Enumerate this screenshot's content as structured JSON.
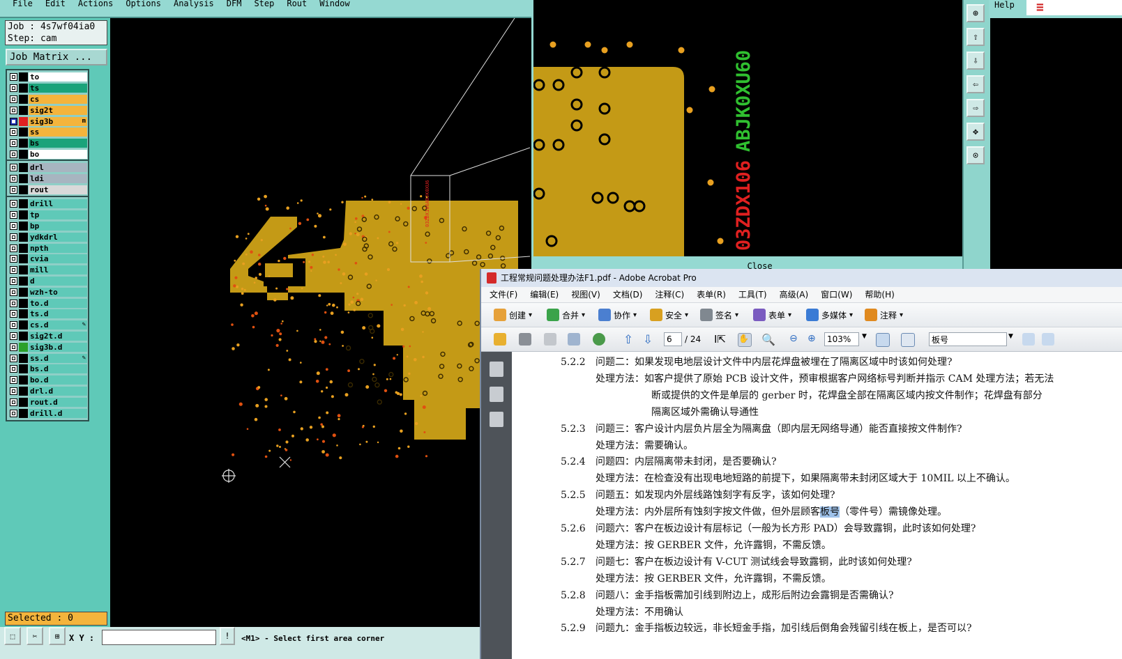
{
  "cam": {
    "menu": [
      "File",
      "Edit",
      "Actions",
      "Options",
      "Analysis",
      "DFM",
      "Step",
      "Rout",
      "Window"
    ],
    "job_label": "Job : 4s7wf04ia0",
    "step_label": "Step: cam",
    "job_matrix_label": "Job Matrix ...",
    "selected_label": "Selected : 0",
    "xy_label": "X Y :",
    "status_message": "<M1> - Select first area corner",
    "zoom_close_label": "Close",
    "help_label": "Help",
    "layer_groups": [
      [
        {
          "name": "to",
          "color": "#ffffff",
          "marker": ""
        },
        {
          "name": "ts",
          "color": "#1aa37a",
          "marker": ""
        },
        {
          "name": "cs",
          "color": "#f4b43c",
          "marker": ""
        },
        {
          "name": "sig2t",
          "color": "#f4b43c",
          "marker": ""
        },
        {
          "name": "sig3b",
          "color": "#f4b43c",
          "marker": "m",
          "swatch": "#e02020",
          "active": true
        },
        {
          "name": "ss",
          "color": "#f4b43c",
          "marker": ""
        },
        {
          "name": "bs",
          "color": "#1aa37a",
          "marker": ""
        },
        {
          "name": "bo",
          "color": "#ffffff",
          "marker": ""
        }
      ],
      [
        {
          "name": "drl",
          "color": "#a7b5c0",
          "marker": ""
        },
        {
          "name": "ldi",
          "color": "#a7b5c0",
          "marker": ""
        },
        {
          "name": "rout",
          "color": "#d9d9d9",
          "marker": ""
        }
      ],
      [
        {
          "name": "drill",
          "color": "#5fc9b8",
          "marker": ""
        },
        {
          "name": "tp",
          "color": "#5fc9b8",
          "marker": ""
        },
        {
          "name": "bp",
          "color": "#5fc9b8",
          "marker": ""
        },
        {
          "name": "ydkdrl",
          "color": "#5fc9b8",
          "marker": ""
        },
        {
          "name": "npth",
          "color": "#5fc9b8",
          "marker": ""
        },
        {
          "name": "cvia",
          "color": "#5fc9b8",
          "marker": ""
        },
        {
          "name": "mill",
          "color": "#5fc9b8",
          "marker": ""
        },
        {
          "name": "d",
          "color": "#5fc9b8",
          "marker": ""
        },
        {
          "name": "wzh-to",
          "color": "#5fc9b8",
          "marker": ""
        },
        {
          "name": "to.d",
          "color": "#5fc9b8",
          "marker": ""
        },
        {
          "name": "ts.d",
          "color": "#5fc9b8",
          "marker": ""
        },
        {
          "name": "cs.d",
          "color": "#5fc9b8",
          "marker": "✎"
        },
        {
          "name": "sig2t.d",
          "color": "#5fc9b8",
          "marker": ""
        },
        {
          "name": "sig3b.d",
          "color": "#5fc9b8",
          "marker": "",
          "swatch": "#2aa02a"
        },
        {
          "name": "ss.d",
          "color": "#5fc9b8",
          "marker": "✎"
        },
        {
          "name": "bs.d",
          "color": "#5fc9b8",
          "marker": ""
        },
        {
          "name": "bo.d",
          "color": "#5fc9b8",
          "marker": ""
        },
        {
          "name": "drl.d",
          "color": "#5fc9b8",
          "marker": ""
        },
        {
          "name": "rout.d",
          "color": "#5fc9b8",
          "marker": ""
        },
        {
          "name": "drill.d",
          "color": "#5fc9b8",
          "marker": ""
        }
      ]
    ],
    "zoom_text_green": "ABJK0XU60",
    "zoom_text_red": "03ZDX106",
    "colors": {
      "copper": "#c49a16",
      "pad": "#e8a020",
      "panel": "#5fc9b8",
      "menubar": "#95d9d2"
    }
  },
  "acrobat": {
    "title": "工程常规问题处理办法F1.pdf - Adobe Acrobat Pro",
    "menu": [
      "文件(F)",
      "编辑(E)",
      "视图(V)",
      "文档(D)",
      "注释(C)",
      "表单(R)",
      "工具(T)",
      "高级(A)",
      "窗口(W)",
      "帮助(H)"
    ],
    "toolbar": [
      "创建",
      "合并",
      "协作",
      "安全",
      "签名",
      "表单",
      "多媒体",
      "注释"
    ],
    "page_current": "6",
    "page_total": "/ 24",
    "zoom": "103%",
    "search_value": "板号",
    "doc_lines": [
      {
        "num": "5.2.2",
        "text": "问题二：如果发现电地层设计文件中内层花焊盘被埋在了隔离区域中时该如何处理?"
      },
      {
        "indent": 1,
        "text": "处理方法：如客户提供了原始 PCB 设计文件，预审根据客户网络标号判断并指示 CAM 处理方法；若无法"
      },
      {
        "indent": 2,
        "text": "断或提供的文件是单层的 gerber 时，花焊盘全部在隔离区域内按文件制作；花焊盘有部分"
      },
      {
        "indent": 2,
        "text": "隔离区域外需确认导通性"
      },
      {
        "num": "5.2.3",
        "text": "问题三：客户设计内层负片层全为隔离盘（即内层无网络导通）能否直接按文件制作?"
      },
      {
        "indent": 1,
        "text": "处理方法：需要确认。"
      },
      {
        "num": "5.2.4",
        "text": "问题四：内层隔离带未封闭，是否要确认?"
      },
      {
        "indent": 1,
        "text": "处理方法：在检查没有出现电地短路的前提下，如果隔离带未封闭区域大于 10MIL 以上不确认。"
      },
      {
        "num": "5.2.5",
        "text": "问题五：如发现内外层线路蚀刻字有反字，该如何处理?"
      },
      {
        "indent": 1,
        "pre": "处理方法：内外层所有蚀刻字按文件做，但外层顾客",
        "hl": "板号",
        "post": "（零件号）需镜像处理。"
      },
      {
        "num": "5.2.6",
        "text": "问题六：客户在板边设计有层标记（一般为长方形 PAD）会导致露铜，此时该如何处理?"
      },
      {
        "indent": 1,
        "text": "处理方法：按 GERBER 文件，允许露铜，不需反馈。"
      },
      {
        "num": "5.2.7",
        "text": "问题七：客户在板边设计有 V-CUT 测试线会导致露铜，此时该如何处理?"
      },
      {
        "indent": 1,
        "text": "处理方法：按 GERBER 文件，允许露铜，不需反馈。"
      },
      {
        "num": "5.2.8",
        "text": "问题八：金手指板需加引线到附边上，成形后附边会露铜是否需确认?"
      },
      {
        "indent": 1,
        "text": "处理方法：不用确认"
      },
      {
        "num": "5.2.9",
        "text": "问题九：金手指板边较远，非长短金手指，加引线后倒角会残留引线在板上，是否可以?"
      }
    ]
  }
}
